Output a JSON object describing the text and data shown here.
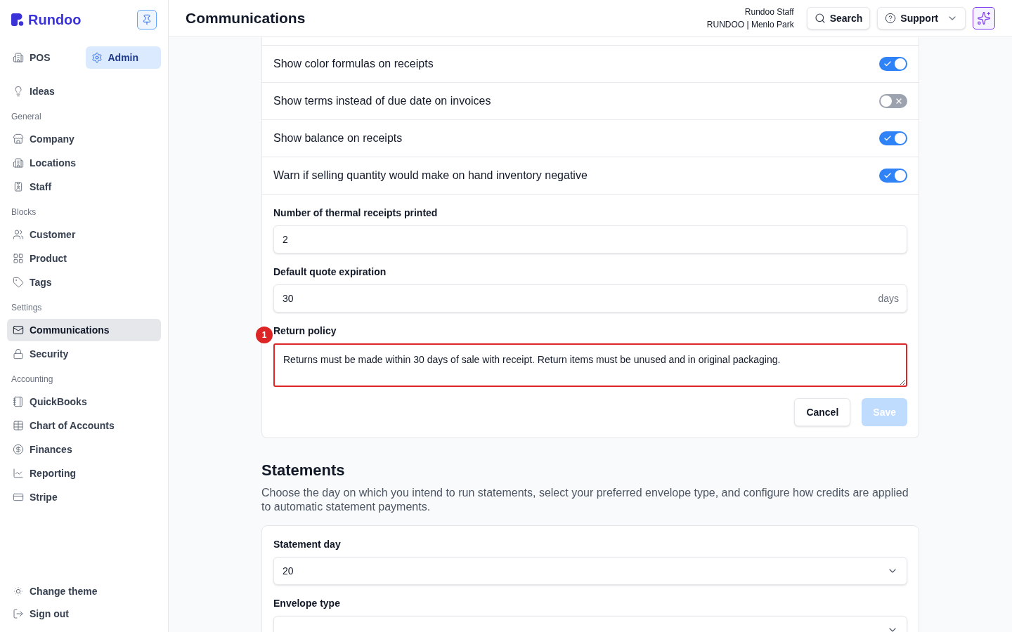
{
  "sidebar": {
    "brand": "Rundoo",
    "mode_tabs": [
      {
        "label": "POS",
        "selected": false
      },
      {
        "label": "Admin",
        "selected": true
      }
    ],
    "items": [
      {
        "label": "Ideas",
        "selected": false
      }
    ],
    "groups": [
      {
        "heading": "General",
        "items": [
          {
            "label": "Company",
            "selected": false
          },
          {
            "label": "Locations",
            "selected": false
          },
          {
            "label": "Staff",
            "selected": false
          }
        ]
      },
      {
        "heading": "Blocks",
        "items": [
          {
            "label": "Customer",
            "selected": false
          },
          {
            "label": "Product",
            "selected": false
          },
          {
            "label": "Tags",
            "selected": false
          }
        ]
      },
      {
        "heading": "Settings",
        "items": [
          {
            "label": "Communications",
            "selected": true
          },
          {
            "label": "Security",
            "selected": false
          }
        ]
      },
      {
        "heading": "Accounting",
        "items": [
          {
            "label": "QuickBooks",
            "selected": false
          },
          {
            "label": "Chart of Accounts",
            "selected": false
          },
          {
            "label": "Finances",
            "selected": false
          },
          {
            "label": "Reporting",
            "selected": false
          },
          {
            "label": "Stripe",
            "selected": false
          }
        ]
      }
    ],
    "footer_items": [
      {
        "label": "Change theme"
      },
      {
        "label": "Sign out"
      }
    ]
  },
  "header": {
    "title": "Communications",
    "user": {
      "name": "Rundoo Staff",
      "location": "RUNDOO | Menlo Park"
    },
    "buttons": [
      {
        "kind": "search",
        "label": "Search"
      },
      {
        "kind": "support",
        "label": "Support"
      },
      {
        "kind": "assistant"
      }
    ]
  },
  "settings_card": {
    "toggles": [
      {
        "label": "Show color formulas on receipts",
        "on": true
      },
      {
        "label": "Show terms instead of due date on invoices",
        "on": false
      },
      {
        "label": "Show balance on receipts",
        "on": true
      },
      {
        "label": "Warn if selling quantity would make on hand inventory negative",
        "on": true
      }
    ],
    "fields": [
      {
        "kind": "input",
        "label": "Number of thermal receipts printed",
        "value": "2"
      },
      {
        "kind": "input",
        "label": "Default quote expiration",
        "value": "30",
        "suffix": "days"
      },
      {
        "kind": "textarea",
        "label": "Return policy",
        "value": "Returns must be made within 30 days of sale with receipt. Return items must be unused and in original packaging.",
        "annotation": "1"
      }
    ],
    "buttons": [
      {
        "kind": "secondary",
        "label": "Cancel",
        "disabled": false
      },
      {
        "kind": "primary",
        "label": "Save",
        "disabled": true
      }
    ]
  },
  "statements": {
    "title": "Statements",
    "description": "Choose the day on which you intend to run statements, select your preferred envelope type, and configure how credits are applied to automatic statement payments.",
    "fields": [
      {
        "kind": "select",
        "label": "Statement day",
        "value": "20"
      },
      {
        "kind": "select",
        "label": "Envelope type"
      }
    ]
  }
}
